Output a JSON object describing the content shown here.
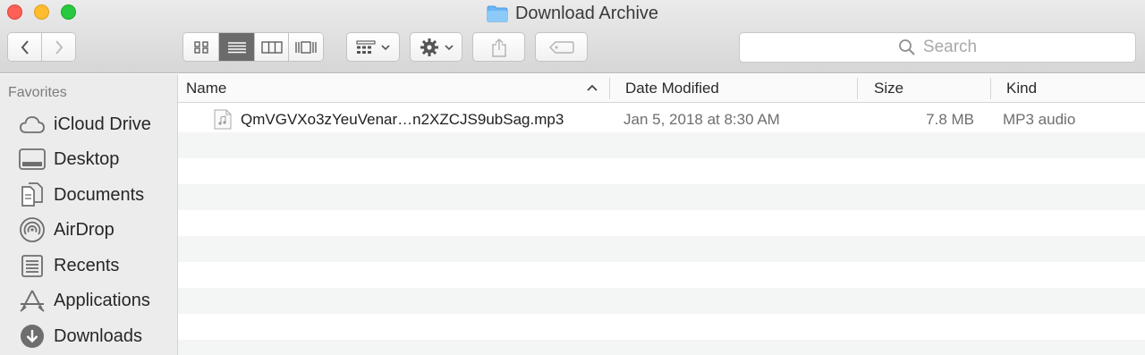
{
  "window": {
    "title": "Download Archive",
    "title_icon": "folder-icon",
    "colors": {
      "folder_blue": "#6cb6f5",
      "close": "#fe5f57",
      "minimize": "#febc2e",
      "zoom": "#28c840",
      "selected_view": "#6b6b6b"
    }
  },
  "toolbar": {
    "back_icon": "chevron-left-icon",
    "forward_icon": "chevron-right-icon",
    "view_modes": [
      "icon-view-icon",
      "list-view-icon",
      "column-view-icon",
      "cover-flow-icon"
    ],
    "selected_view": "list-view-icon",
    "group_icon": "group-arrange-icon",
    "action_icon": "gear-icon",
    "share_icon": "share-icon",
    "tag_icon": "tag-icon"
  },
  "search": {
    "placeholder": "Search",
    "icon": "search-icon"
  },
  "sidebar": {
    "heading": "Favorites",
    "items": [
      {
        "label": "iCloud Drive",
        "icon": "cloud-icon"
      },
      {
        "label": "Desktop",
        "icon": "desktop-icon"
      },
      {
        "label": "Documents",
        "icon": "documents-icon"
      },
      {
        "label": "AirDrop",
        "icon": "airdrop-icon"
      },
      {
        "label": "Recents",
        "icon": "recents-icon"
      },
      {
        "label": "Applications",
        "icon": "applications-icon"
      },
      {
        "label": "Downloads",
        "icon": "downloads-icon"
      }
    ]
  },
  "list": {
    "columns": {
      "name": "Name",
      "date": "Date Modified",
      "size": "Size",
      "kind": "Kind"
    },
    "sort_column": "Name",
    "sort_direction": "ascending",
    "files": [
      {
        "name": "QmVGVXo3zYeuVenar…n2XZCJS9ubSag.mp3",
        "date": "Jan 5, 2018 at 8:30 AM",
        "size": "7.8 MB",
        "kind": "MP3 audio",
        "icon": "audio-file-icon"
      }
    ]
  }
}
